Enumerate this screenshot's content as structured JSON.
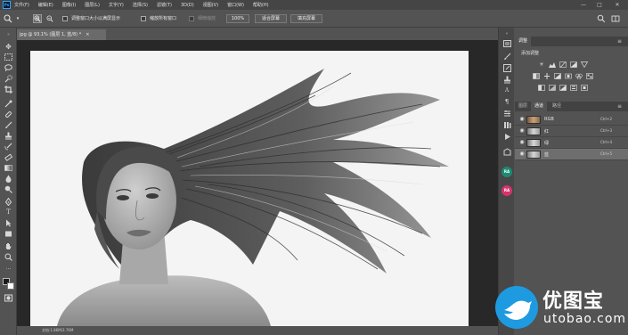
{
  "app": {
    "logo_text": "Ps"
  },
  "menubar": {
    "items": [
      "文件(F)",
      "编辑(E)",
      "图像(I)",
      "图层(L)",
      "文字(Y)",
      "选择(S)",
      "滤镜(T)",
      "3D(D)",
      "视图(V)",
      "窗口(W)",
      "帮助(H)"
    ],
    "window_controls": {
      "minimize": "—",
      "maximize": "□",
      "close": "✕"
    }
  },
  "options_bar": {
    "resize_windows_label": "调整窗口大小以满屏显示",
    "zoom_all_windows_label": "缩放所有窗口",
    "scrubby_zoom_label": "细微缩放",
    "zoom_percent": "100%",
    "fit_screen_label": "适合屏幕",
    "fill_screen_label": "填充屏幕"
  },
  "document": {
    "tab_label": "jpg @ 93.1% (图层 1, 蓝/8) *",
    "close_glyph": "×",
    "status_text": "文档:1.86M/3.76M"
  },
  "right_panel": {
    "adjustments_tab": "调整",
    "add_adjustment_label": "添加调整",
    "layer_tabs": [
      "图层",
      "通道",
      "路径"
    ],
    "active_layer_tab": "通道",
    "channels": [
      {
        "name": "RGB",
        "shortcut": "Ctrl+2",
        "visible": true,
        "selected": false
      },
      {
        "name": "红",
        "shortcut": "Ctrl+3",
        "visible": true,
        "selected": false
      },
      {
        "name": "绿",
        "shortcut": "Ctrl+4",
        "visible": true,
        "selected": false
      },
      {
        "name": "蓝",
        "shortcut": "Ctrl+5",
        "visible": true,
        "selected": true
      }
    ]
  },
  "panel_strip": {
    "ra_label_1": "RA",
    "ra_label_2": "RA"
  },
  "watermark": {
    "brand": "优图宝",
    "url": "utobao.com"
  },
  "colors": {
    "accent": "#31a8ff",
    "watermark_blue": "#1e9be0",
    "ra_teal": "#1d8a74",
    "ra_pink": "#d6336c"
  }
}
